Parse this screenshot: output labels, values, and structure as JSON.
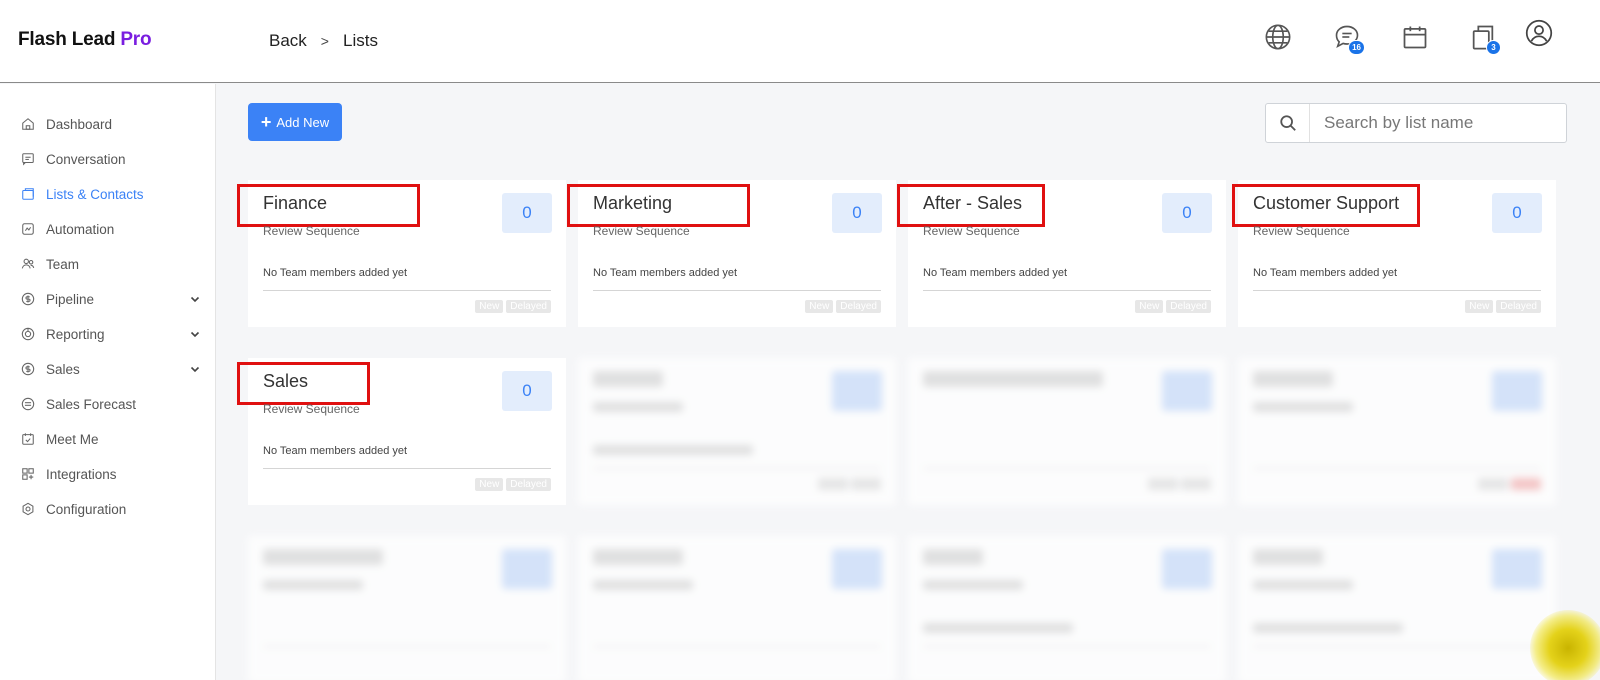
{
  "brand": {
    "name": "Flash Lead ",
    "accent": "Pro"
  },
  "breadcrumb": {
    "back": "Back",
    "separator": ">",
    "current": "Lists"
  },
  "header_icons": [
    {
      "name": "globe-icon"
    },
    {
      "name": "chat-icon",
      "badge": "16"
    },
    {
      "name": "calendar-icon"
    },
    {
      "name": "copy-icon",
      "badge": "3"
    },
    {
      "name": "user-icon"
    }
  ],
  "sidebar": {
    "items": [
      {
        "label": "Dashboard",
        "icon": "home-icon"
      },
      {
        "label": "Conversation",
        "icon": "message-icon"
      },
      {
        "label": "Lists & Contacts",
        "icon": "folder-icon",
        "active": true
      },
      {
        "label": "Automation",
        "icon": "automation-icon"
      },
      {
        "label": "Team",
        "icon": "team-icon"
      },
      {
        "label": "Pipeline",
        "icon": "dollar-icon",
        "expandable": true
      },
      {
        "label": "Reporting",
        "icon": "report-icon",
        "expandable": true
      },
      {
        "label": "Sales",
        "icon": "dollar-icon",
        "expandable": true
      },
      {
        "label": "Sales Forecast",
        "icon": "forecast-icon"
      },
      {
        "label": "Meet Me",
        "icon": "calendar-check-icon"
      },
      {
        "label": "Integrations",
        "icon": "integrations-icon"
      },
      {
        "label": "Configuration",
        "icon": "gear-icon"
      }
    ]
  },
  "toolbar": {
    "add_label": "Add New",
    "search_placeholder": "Search by list name"
  },
  "lists": [
    {
      "title": "Finance",
      "count": "0",
      "subtitle": "Review Sequence",
      "note": "No Team members added yet",
      "tags": [
        "New",
        "Delayed"
      ]
    },
    {
      "title": "Marketing",
      "count": "0",
      "subtitle": "Review Sequence",
      "note": "No Team members added yet",
      "tags": [
        "New",
        "Delayed"
      ]
    },
    {
      "title": "After - Sales",
      "count": "0",
      "subtitle": "Review Sequence",
      "note": "No Team members added yet",
      "tags": [
        "New",
        "Delayed"
      ]
    },
    {
      "title": "Customer Support",
      "count": "0",
      "subtitle": "Review Sequence",
      "note": "No Team members added yet",
      "tags": [
        "New",
        "Delayed"
      ]
    },
    {
      "title": "Sales",
      "count": "0",
      "subtitle": "Review Sequence",
      "note": "No Team members added yet",
      "tags": [
        "New",
        "Delayed"
      ]
    }
  ],
  "colors": {
    "primary": "#3b82f6",
    "brand_accent": "#7a1ee0",
    "highlight": "#e01010"
  }
}
